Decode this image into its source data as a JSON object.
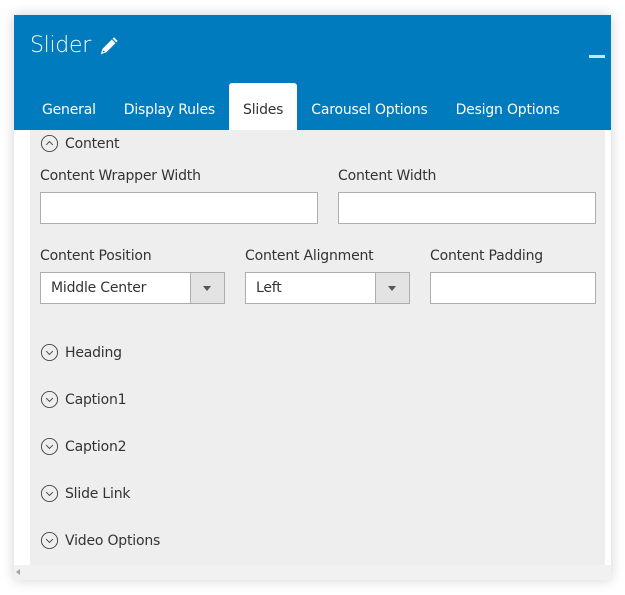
{
  "header": {
    "title": "Slider",
    "title_icon": "pencil-icon",
    "minimize_icon": "minimize-icon"
  },
  "tabs": [
    {
      "label": "General",
      "active": false
    },
    {
      "label": "Display Rules",
      "active": false
    },
    {
      "label": "Slides",
      "active": true
    },
    {
      "label": "Carousel Options",
      "active": false
    },
    {
      "label": "Design Options",
      "active": false
    }
  ],
  "content_section": {
    "title": "Content",
    "expanded": true,
    "icon": "chevron-up-circle-icon",
    "fields": {
      "wrapper_width": {
        "label": "Content Wrapper Width",
        "value": ""
      },
      "width": {
        "label": "Content Width",
        "value": ""
      },
      "position": {
        "label": "Content Position",
        "value": "Middle Center"
      },
      "alignment": {
        "label": "Content Alignment",
        "value": "Left"
      },
      "padding": {
        "label": "Content Padding",
        "value": ""
      }
    }
  },
  "collapsed_sections": [
    {
      "title": "Heading",
      "icon": "chevron-down-circle-icon"
    },
    {
      "title": "Caption1",
      "icon": "chevron-down-circle-icon"
    },
    {
      "title": "Caption2",
      "icon": "chevron-down-circle-icon"
    },
    {
      "title": "Slide Link",
      "icon": "chevron-down-circle-icon"
    },
    {
      "title": "Video Options",
      "icon": "chevron-down-circle-icon"
    }
  ],
  "colors": {
    "header_bg": "#007bbd",
    "content_bg": "#eeeeee"
  }
}
